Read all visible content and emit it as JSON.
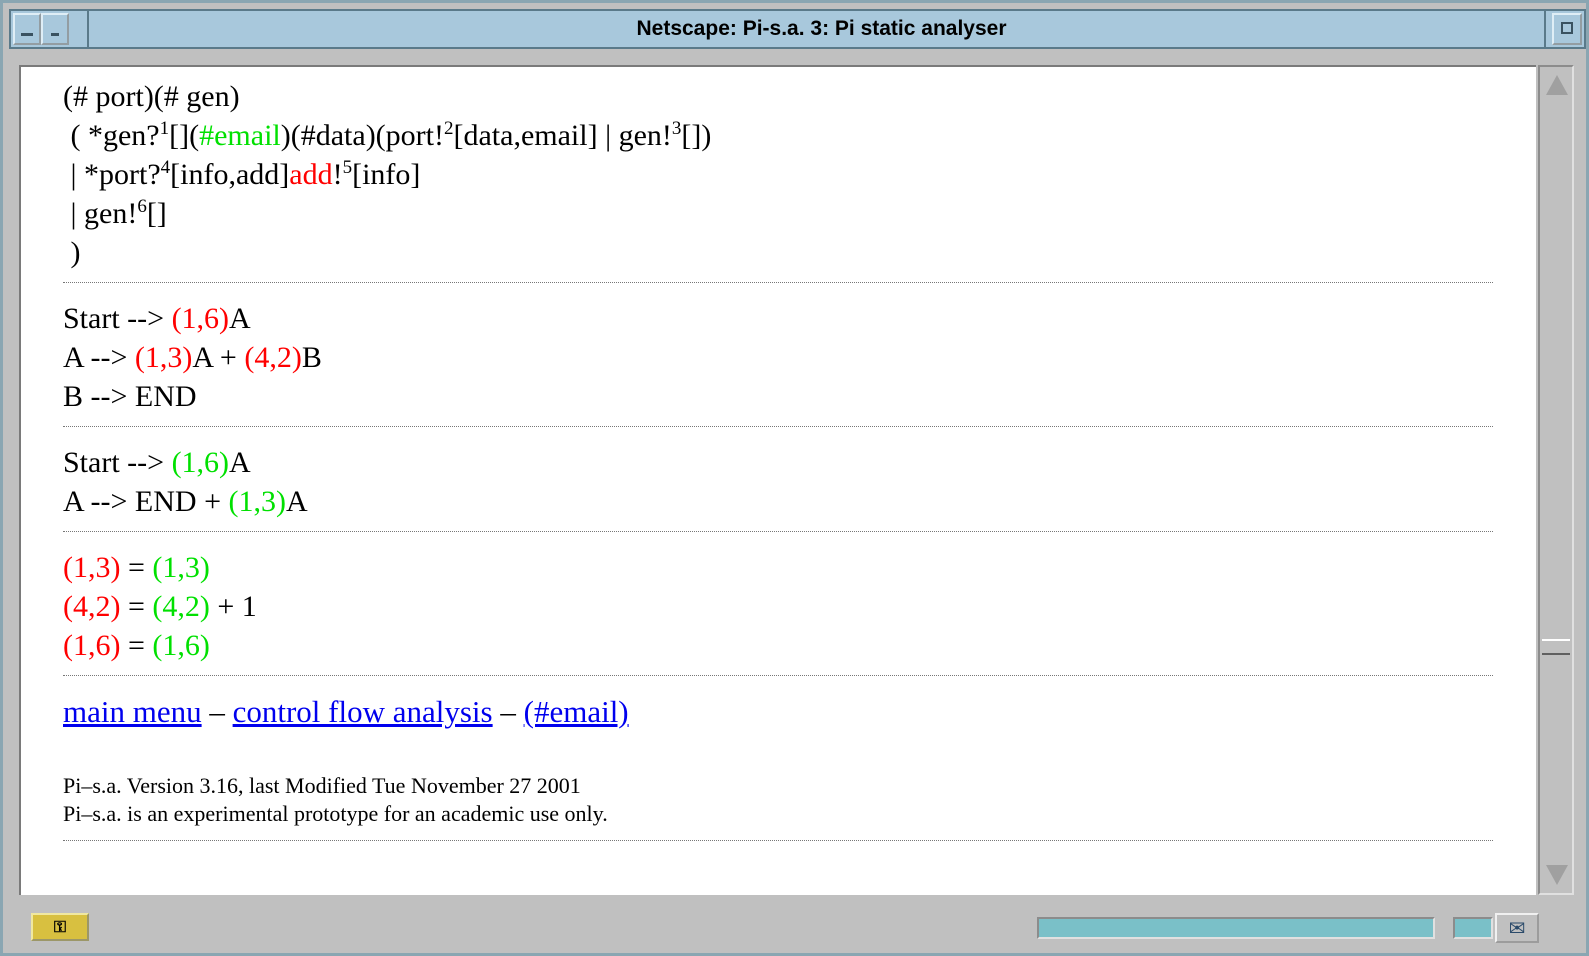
{
  "window": {
    "title": "Netscape: Pi-s.a. 3: Pi static analyser"
  },
  "process": {
    "l1": "(# port)(# gen)",
    "l2a": " ( *gen?",
    "l2_s1": "1",
    "l2b": "[](",
    "l2_email": "#email",
    "l2c": ")(#data)(port!",
    "l2_s2": "2",
    "l2d": "[data,email] | gen!",
    "l2_s3": "3",
    "l2e": "[])",
    "l3a": " | *port?",
    "l3_s4": "4",
    "l3b": "[info,add]",
    "l3_add": "add",
    "l3c": "!",
    "l3_s5": "5",
    "l3d": "[info]",
    "l4a": " | gen!",
    "l4_s6": "6",
    "l4b": "[]",
    "l5": " )"
  },
  "grammar1": {
    "r1a": "Start --> ",
    "r1b": "(1,6)",
    "r1c": "A",
    "r2a": "A --> ",
    "r2b": "(1,3)",
    "r2c": "A + ",
    "r2d": "(4,2)",
    "r2e": "B",
    "r3": "B --> END"
  },
  "grammar2": {
    "r1a": "Start --> ",
    "r1b": "(1,6)",
    "r1c": "A",
    "r2a": "A --> END + ",
    "r2b": "(1,3)",
    "r2c": "A"
  },
  "equations": {
    "e1a": "(1,3)",
    "e1b": " = ",
    "e1c": "(1,3)",
    "e2a": "(4,2)",
    "e2b": " = ",
    "e2c": "(4,2)",
    "e2d": " + 1",
    "e3a": "(1,6)",
    "e3b": " = ",
    "e3c": "(1,6)"
  },
  "links": {
    "main_menu": "main menu",
    "sep1": " – ",
    "cfa": "control flow analysis",
    "sep2": " – ",
    "email": "(#email)"
  },
  "footer": {
    "line1": "Pi–s.a. Version 3.16, last Modified Tue November 27 2001",
    "line2": "Pi–s.a. is an experimental prototype for an academic use only."
  },
  "statusbar": {
    "security_icon": "lock-key-icon",
    "mail_icon": "mail-icon"
  }
}
